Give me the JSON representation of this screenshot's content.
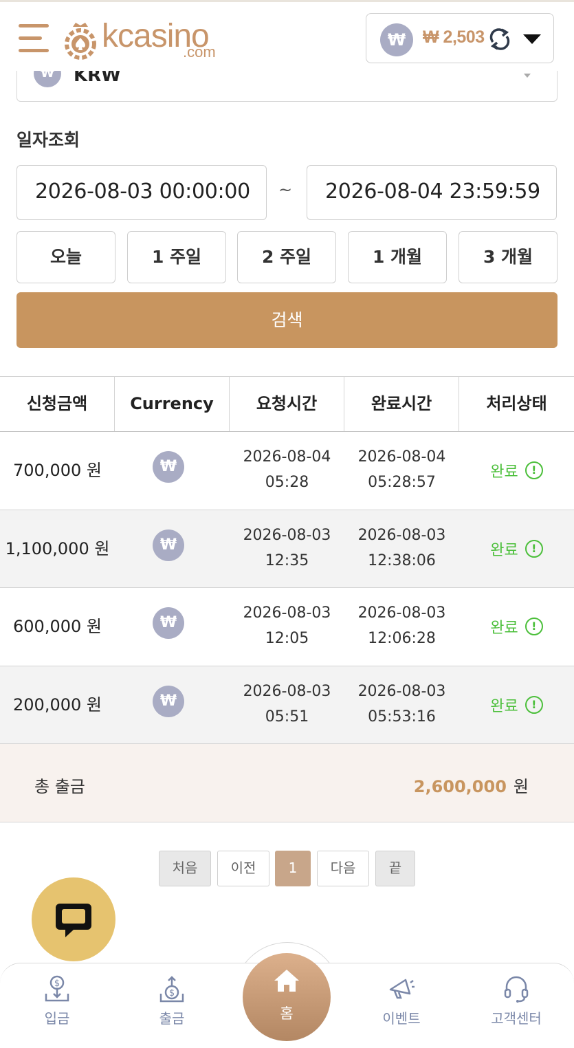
{
  "header": {
    "logo_text": "kcasino",
    "logo_sub": ".com",
    "currency_symbol": "₩",
    "balance": "₩ 2,503"
  },
  "currency_select": {
    "value": "KRW",
    "icon": "₩"
  },
  "date_search": {
    "label": "일자조회",
    "from": "2026-08-03 00:00:00",
    "separator": "~",
    "to": "2026-08-04 23:59:59",
    "ranges": [
      "오늘",
      "1 주일",
      "2 주일",
      "1 개월",
      "3 개월"
    ],
    "search_label": "검색"
  },
  "table": {
    "headers": [
      "신청금액",
      "Currency",
      "요청시간",
      "완료시간",
      "처리상태"
    ],
    "rows": [
      {
        "amount": "700,000 원",
        "currency": "₩",
        "req_date": "2026-08-04",
        "req_time": "05:28",
        "done_date": "2026-08-04",
        "done_time": "05:28:57",
        "status": "완료"
      },
      {
        "amount": "1,100,000 원",
        "currency": "₩",
        "req_date": "2026-08-03",
        "req_time": "12:35",
        "done_date": "2026-08-03",
        "done_time": "12:38:06",
        "status": "완료"
      },
      {
        "amount": "600,000 원",
        "currency": "₩",
        "req_date": "2026-08-03",
        "req_time": "12:05",
        "done_date": "2026-08-03",
        "done_time": "12:06:28",
        "status": "완료"
      },
      {
        "amount": "200,000 원",
        "currency": "₩",
        "req_date": "2026-08-03",
        "req_time": "05:51",
        "done_date": "2026-08-03",
        "done_time": "05:53:16",
        "status": "완료"
      }
    ],
    "total_label": "총 출금",
    "total_value": "2,600,000",
    "total_unit": "원"
  },
  "pagination": {
    "first": "처음",
    "prev": "이전",
    "current": "1",
    "next": "다음",
    "last": "끝"
  },
  "bottom_nav": {
    "deposit": "입금",
    "withdraw": "출금",
    "home": "홈",
    "event": "이벤트",
    "support": "고객센터"
  },
  "colors": {
    "brand": "#c8956a",
    "button": "#c8955f",
    "success": "#4bbf3a",
    "currency_icon": "#a9acc4",
    "chat": "#e6c36f"
  }
}
